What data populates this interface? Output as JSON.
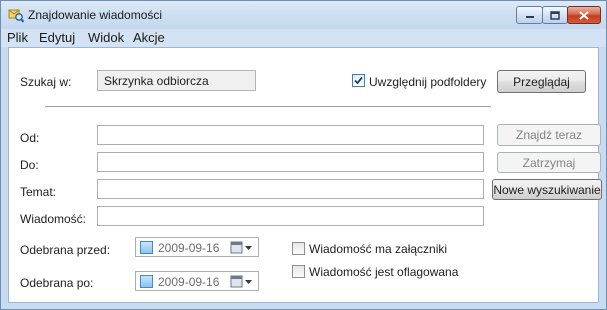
{
  "window": {
    "title": "Znajdowanie wiadomości",
    "icon": "find-messages-icon"
  },
  "menu": [
    "Plik",
    "Edytuj",
    "Widok",
    "Akcje"
  ],
  "search_in": {
    "label": "Szukaj w:",
    "value": "Skrzynka odbiorcza",
    "include_subfolders_label": "Uwzględnij podfoldery",
    "include_subfolders_checked": true,
    "browse_label": "Przeglądaj"
  },
  "fields": {
    "from_label": "Od:",
    "from_value": "",
    "to_label": "Do:",
    "to_value": "",
    "subject_label": "Temat:",
    "subject_value": "",
    "message_label": "Wiadomość:",
    "message_value": ""
  },
  "buttons": {
    "find_now": "Znajdź teraz",
    "stop": "Zatrzymaj",
    "new_search": "Nowe wyszukiwanie"
  },
  "dates": {
    "received_before_label": "Odebrana przed:",
    "received_before_value": "2009-09-16",
    "received_after_label": "Odebrana po:",
    "received_after_value": "2009-09-16"
  },
  "options": {
    "has_attachments_label": "Wiadomość ma załączniki",
    "has_attachments_checked": false,
    "flagged_label": "Wiadomość jest oflagowana",
    "flagged_checked": false
  },
  "colors": {
    "frame": "#c9dbef",
    "close_button": "#c13e1f",
    "checkbox_accent": "#3f8ad2"
  }
}
